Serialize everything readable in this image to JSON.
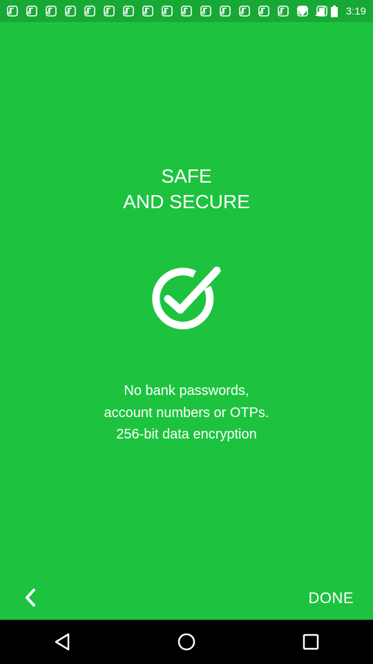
{
  "status_bar": {
    "time": "3:19",
    "notification_icons": [
      "notification-icon",
      "notification-icon",
      "notification-icon",
      "notification-icon",
      "notification-icon",
      "notification-icon",
      "notification-icon",
      "notification-icon",
      "notification-icon",
      "notification-icon",
      "notification-icon",
      "notification-icon",
      "notification-icon",
      "notification-icon",
      "notification-icon",
      "notification-icon",
      "notification-icon"
    ],
    "wifi_icon": "wifi-icon",
    "signal_icon": "cell-signal-icon",
    "battery_icon": "battery-icon"
  },
  "main": {
    "title_line1": "SAFE",
    "title_line2": "AND SECURE",
    "icon": "check-circle-icon",
    "description_line1": "No bank passwords,",
    "description_line2": "account numbers or OTPs.",
    "description_line3": "256-bit data encryption"
  },
  "footer": {
    "back_icon": "chevron-left-icon",
    "done_label": "DONE"
  },
  "nav_bar": {
    "back_icon": "nav-back-icon",
    "home_icon": "nav-home-icon",
    "recents_icon": "nav-recents-icon"
  },
  "colors": {
    "background": "#1dc33f",
    "status_bar": "#17a836",
    "nav_bar": "#000000",
    "text": "#ffffff"
  }
}
